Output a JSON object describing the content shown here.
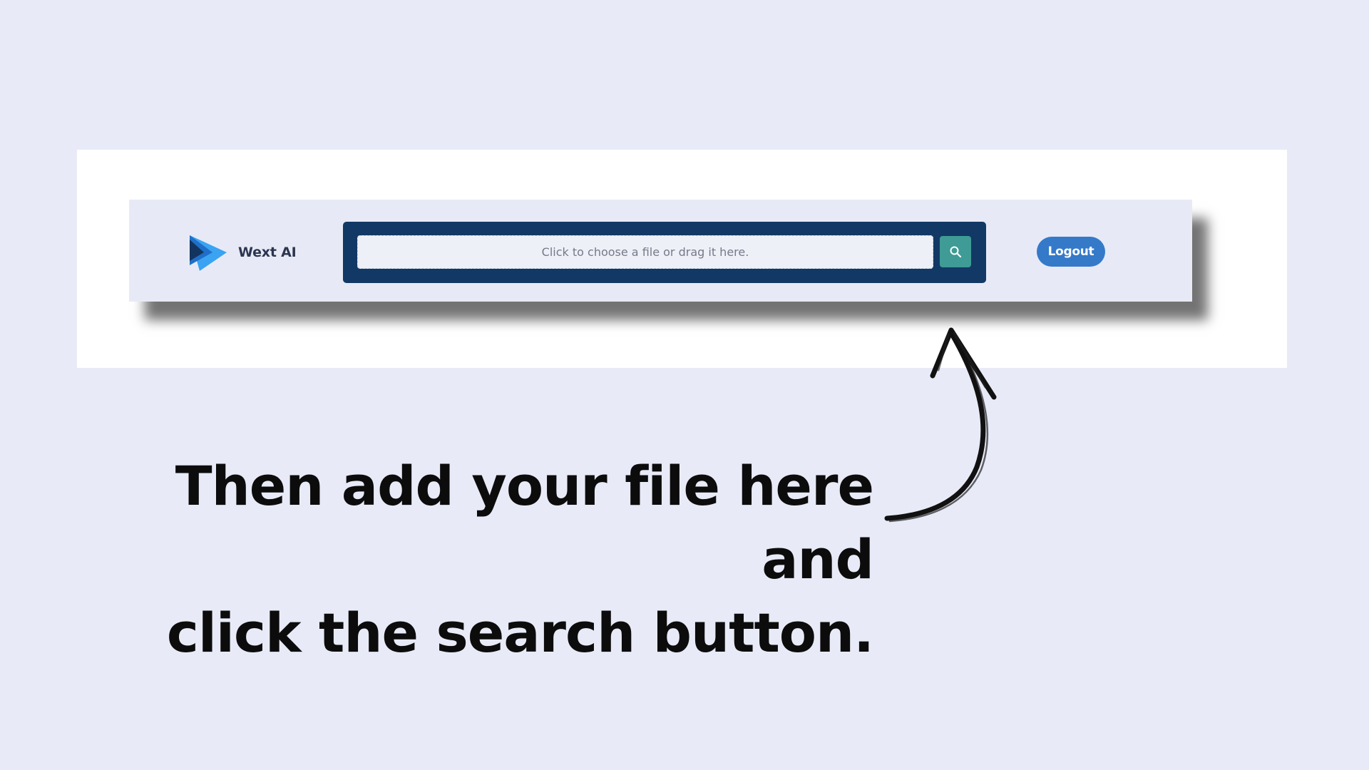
{
  "app": {
    "brand_name": "Wext AI"
  },
  "search": {
    "placeholder": "Click to choose a file or drag it here.",
    "button_icon": "search-icon"
  },
  "header": {
    "logout_label": "Logout"
  },
  "instruction": {
    "line1": "Then add your file here and",
    "line2": "click the search button."
  },
  "colors": {
    "page_background": "#e8ebf7",
    "search_frame": "#123865",
    "search_button": "#3e9b95",
    "logout_button": "#3579c9",
    "logo_blue": "#2f8fe6"
  }
}
